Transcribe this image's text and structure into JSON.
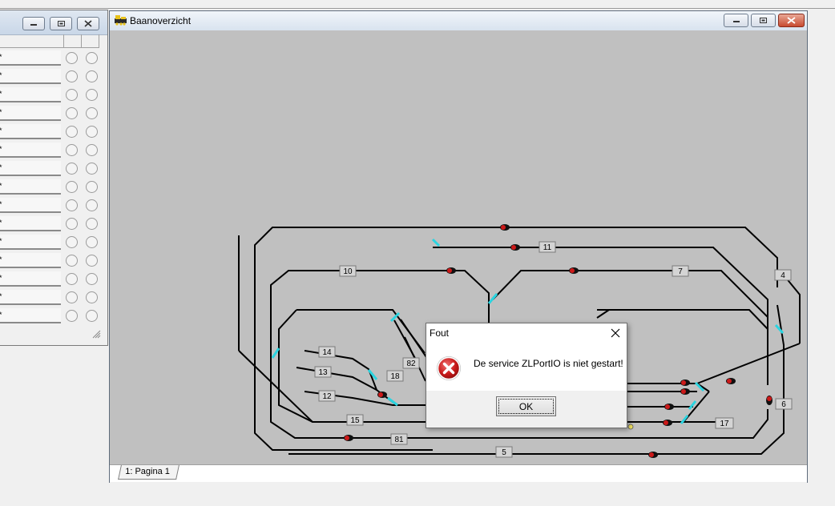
{
  "main_window": {
    "title": "Baanoverzicht",
    "tab_label": "1: Pagina 1"
  },
  "left_panel": {
    "row_marker": "*",
    "row_count": 15
  },
  "layout": {
    "block_labels": [
      "11",
      "10",
      "7",
      "4",
      "14",
      "13",
      "82",
      "18",
      "12",
      "15",
      "81",
      "5",
      "17",
      "6"
    ],
    "track_color": "#000000",
    "turnout_color": "#2ad4e0",
    "signal_color": "#cc1a1a",
    "background_color": "#c0c0c0"
  },
  "dialog": {
    "title": "Fout",
    "message": "De service ZLPortIO is niet gestart!",
    "ok_label": "OK",
    "icon": "error-icon"
  }
}
